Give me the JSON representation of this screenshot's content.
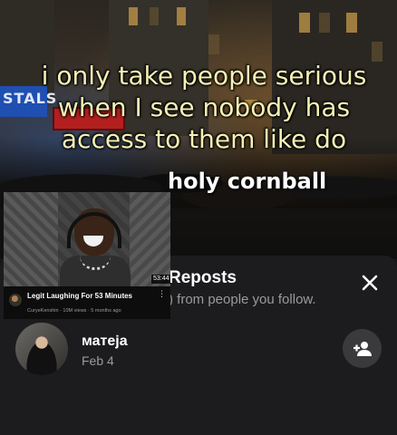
{
  "caption": {
    "line1": "i only take people serious",
    "line2": "when I see nobody has",
    "line3": "access to them like do"
  },
  "subcaption": "holy cornball",
  "background_sign": "STALS",
  "video_card": {
    "title": "Legit Laughing For 53 Minutes",
    "meta": "CuryeKenshin · 10M views · 5 months ago",
    "duration": "53:44"
  },
  "reposts_sheet": {
    "title": "Reposts",
    "subtitle": ") from people you follow.",
    "close_icon": "close-icon",
    "user": {
      "name": "матеја",
      "date": "Feb 4",
      "follow_icon": "add-user-icon"
    }
  },
  "colors": {
    "sheet_bg": "#1c1c1e",
    "caption_text": "#f6f0b4",
    "secondary_text": "#9a9a9e",
    "follow_button_bg": "#3a3a3c"
  }
}
